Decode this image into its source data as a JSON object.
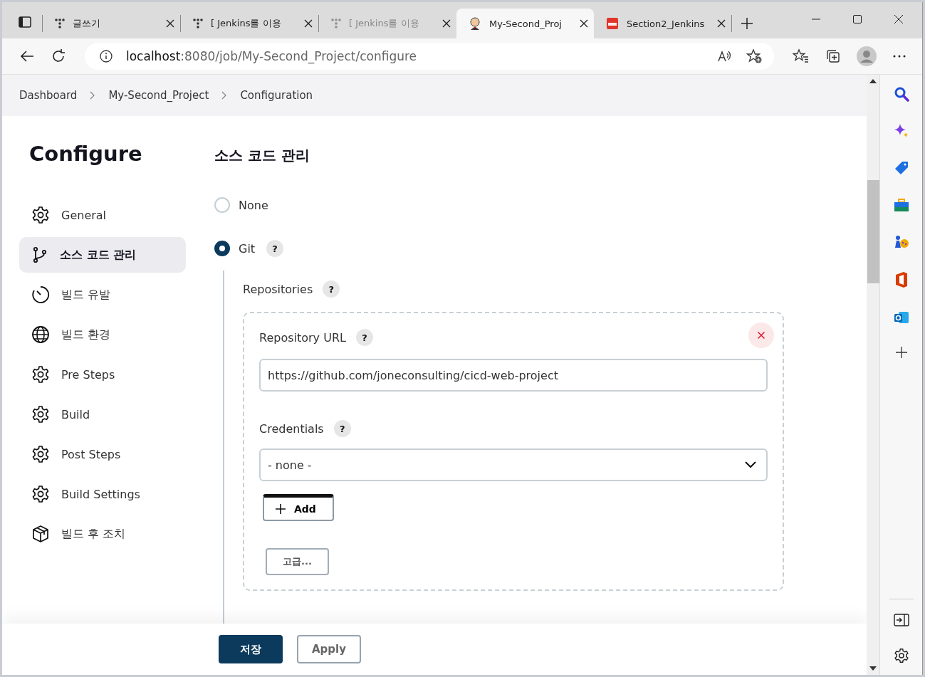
{
  "tabs": [
    {
      "title": "글쓰기",
      "selected": false,
      "faded": false
    },
    {
      "title": "[ Jenkins를 이용",
      "selected": false,
      "faded": false
    },
    {
      "title": "[ Jenkins를 이용",
      "selected": false,
      "faded": true
    },
    {
      "title": "My-Second_Proj",
      "selected": true,
      "faded": false
    },
    {
      "title": "Section2_Jenkins",
      "selected": false,
      "faded": false
    }
  ],
  "address": {
    "host": "localhost",
    "rest": ":8080/job/My-Second_Project/configure"
  },
  "breadcrumbs": [
    "Dashboard",
    "My-Second_Project",
    "Configuration"
  ],
  "sidebar": {
    "title": "Configure",
    "items": [
      {
        "label": "General",
        "selected": false
      },
      {
        "label": "소스 코드 관리",
        "selected": true
      },
      {
        "label": "빌드 유발",
        "selected": false
      },
      {
        "label": "빌드 환경",
        "selected": false
      },
      {
        "label": "Pre Steps",
        "selected": false
      },
      {
        "label": "Build",
        "selected": false
      },
      {
        "label": "Post Steps",
        "selected": false
      },
      {
        "label": "Build Settings",
        "selected": false
      },
      {
        "label": "빌드 후 조치",
        "selected": false
      }
    ]
  },
  "section": {
    "title": "소스 코드 관리",
    "options": [
      {
        "label": "None",
        "selected": false
      },
      {
        "label": "Git",
        "selected": true,
        "help": "?"
      }
    ],
    "repositories_label": "Repositories",
    "repositories_help": "?",
    "repository": {
      "url_label": "Repository URL",
      "url_help": "?",
      "url_value": "https://github.com/joneconsulting/cicd-web-project",
      "credentials_label": "Credentials",
      "credentials_help": "?",
      "credentials_value": "- none -",
      "add_button": "Add",
      "advanced_button": "고급..."
    }
  },
  "footer": {
    "save_button": "저장",
    "apply_button": "Apply"
  }
}
